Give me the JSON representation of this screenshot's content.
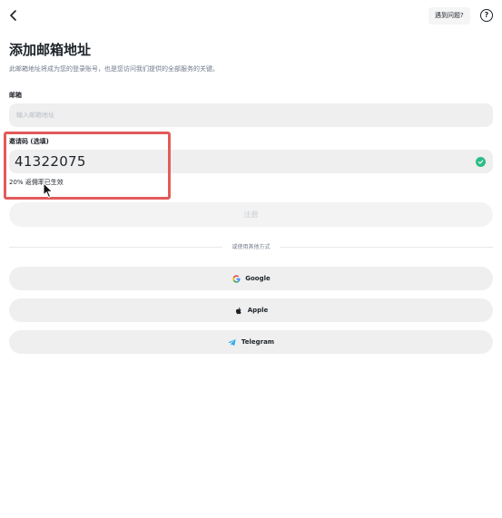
{
  "header": {
    "back_icon": "chevron-left-icon",
    "help_pill_label": "遇到问题?",
    "help_icon_glyph": "?"
  },
  "page": {
    "title": "添加邮箱地址",
    "subtitle": "此邮箱地址将成为您的登录账号，也是您访问我们提供的全部服务的关键。"
  },
  "email_field": {
    "label": "邮箱",
    "placeholder": "输入邮箱地址",
    "value": ""
  },
  "invite_field": {
    "label": "邀请码 (选填)",
    "value": "41322075",
    "status_icon": "check-circle-icon",
    "status_color": "#2ebd85",
    "note": "20% 返佣率已生效"
  },
  "register_button": {
    "label": "注册"
  },
  "divider": {
    "text": "或使用其他方式"
  },
  "social": [
    {
      "label": "Google",
      "icon": "google-icon"
    },
    {
      "label": "Apple",
      "icon": "apple-icon"
    },
    {
      "label": "Telegram",
      "icon": "telegram-icon"
    }
  ],
  "colors": {
    "highlight": "#e25b5b",
    "input_bg": "#efefef",
    "success": "#2ebd85"
  }
}
